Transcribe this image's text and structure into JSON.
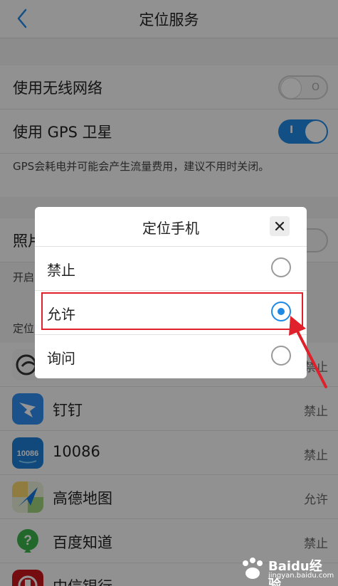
{
  "header": {
    "title": "定位服务"
  },
  "settings": {
    "wireless_label": "使用无线网络",
    "gps_label": "使用 GPS 卫星",
    "gps_note": "GPS会耗电并可能会产生流量费用，建议不用时关闭。",
    "gps_on_mark": "I",
    "wireless_off_mark": "O",
    "photo_label": "照片",
    "photo_note": "开启",
    "section_label": "定位"
  },
  "apps": [
    {
      "name": "",
      "perm": "禁止",
      "icon": "shopping-app-icon"
    },
    {
      "name": "钉钉",
      "perm": "禁止",
      "icon": "dingtalk-icon"
    },
    {
      "name": "10086",
      "perm": "禁止",
      "icon": "10086-icon"
    },
    {
      "name": "高德地图",
      "perm": "允许",
      "icon": "amap-icon"
    },
    {
      "name": "百度知道",
      "perm": "禁止",
      "icon": "baidu-zhidao-icon"
    },
    {
      "name": "中信银行",
      "perm": "",
      "icon": "citic-bank-icon"
    }
  ],
  "icon_labels": {
    "app_10086": "10086"
  },
  "dialog": {
    "title": "定位手机",
    "close_glyph": "✕",
    "options": [
      {
        "label": "禁止",
        "selected": false
      },
      {
        "label": "允许",
        "selected": true
      },
      {
        "label": "询问",
        "selected": false
      }
    ]
  },
  "watermark": {
    "logo": "Baidu经验",
    "domain": "jingyan.baidu.com"
  },
  "colors": {
    "accent": "#1e88e5",
    "annotation": "#e0202a"
  }
}
